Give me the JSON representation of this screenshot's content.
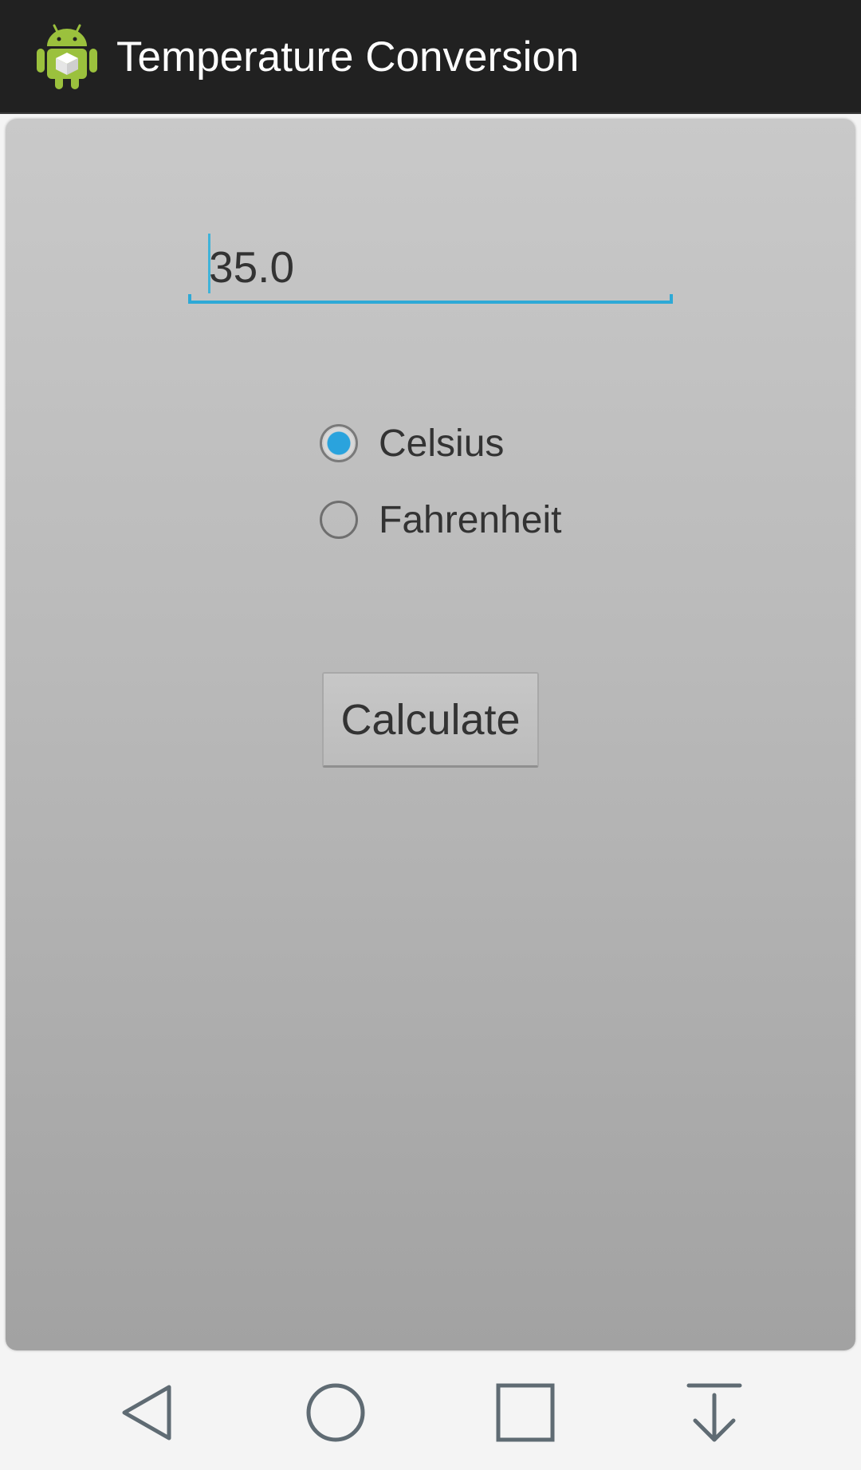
{
  "app_bar": {
    "title": "Temperature Conversion",
    "icon": "android-app-icon"
  },
  "form": {
    "temperature_input": {
      "value": "35.0"
    },
    "unit_options": [
      {
        "label": "Celsius",
        "checked": true
      },
      {
        "label": "Fahrenheit",
        "checked": false
      }
    ],
    "calculate_label": "Calculate"
  },
  "nav_bar": {
    "icons": [
      "back-icon",
      "home-icon",
      "recents-icon",
      "notifications-pulldown-icon"
    ]
  },
  "colors": {
    "accent": "#2ea9d6",
    "app_bar": "#212121",
    "android_green": "#9bc13d"
  }
}
